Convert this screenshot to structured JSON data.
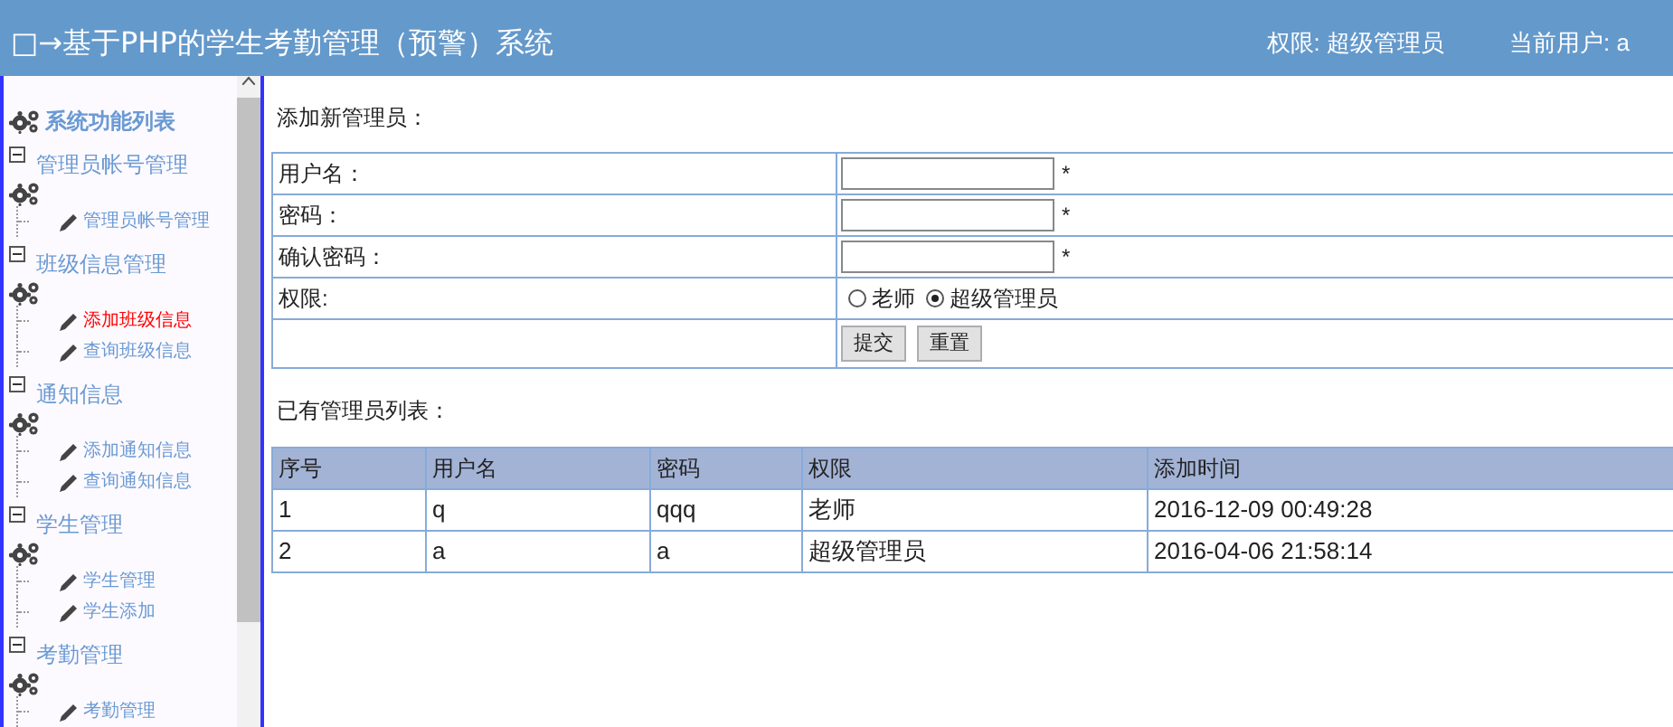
{
  "header": {
    "title": "□→基于PHP的学生考勤管理（预警）系统",
    "role": "权限: 超级管理员",
    "user": "当前用户: a"
  },
  "sidebar": {
    "title": "系统功能列表",
    "groups": [
      {
        "title": "管理员帐号管理",
        "expanded": true,
        "children": [
          {
            "label": "管理员帐号管理",
            "selected": false
          }
        ]
      },
      {
        "title": "班级信息管理",
        "expanded": true,
        "children": [
          {
            "label": "添加班级信息",
            "selected": true
          },
          {
            "label": "查询班级信息",
            "selected": false
          }
        ]
      },
      {
        "title": "通知信息",
        "expanded": true,
        "children": [
          {
            "label": "添加通知信息",
            "selected": false
          },
          {
            "label": "查询通知信息",
            "selected": false
          }
        ]
      },
      {
        "title": "学生管理",
        "expanded": true,
        "children": [
          {
            "label": "学生管理",
            "selected": false
          },
          {
            "label": "学生添加",
            "selected": false
          }
        ]
      },
      {
        "title": "考勤管理",
        "expanded": true,
        "children": [
          {
            "label": "考勤管理",
            "selected": false
          }
        ]
      }
    ]
  },
  "form": {
    "title": "添加新管理员：",
    "rows": [
      {
        "kind": "text",
        "label": "用户名：",
        "required": "*"
      },
      {
        "kind": "text",
        "label": "密码：",
        "required": "*"
      },
      {
        "kind": "text",
        "label": "确认密码：",
        "required": "*"
      },
      {
        "kind": "radio",
        "label": "权限:",
        "options": [
          {
            "label": "老师",
            "selected": false
          },
          {
            "label": "超级管理员",
            "selected": true
          }
        ]
      },
      {
        "kind": "buttons",
        "buttons": [
          "提交",
          "重置"
        ]
      }
    ]
  },
  "table": {
    "title": "已有管理员列表：",
    "columns": [
      "序号",
      "用户名",
      "密码",
      "权限",
      "添加时间"
    ],
    "rows": [
      [
        "1",
        "q",
        "qqq",
        "老师",
        "2016-12-09 00:49:28"
      ],
      [
        "2",
        "a",
        "a",
        "超级管理员",
        "2016-04-06 21:58:14"
      ]
    ]
  }
}
